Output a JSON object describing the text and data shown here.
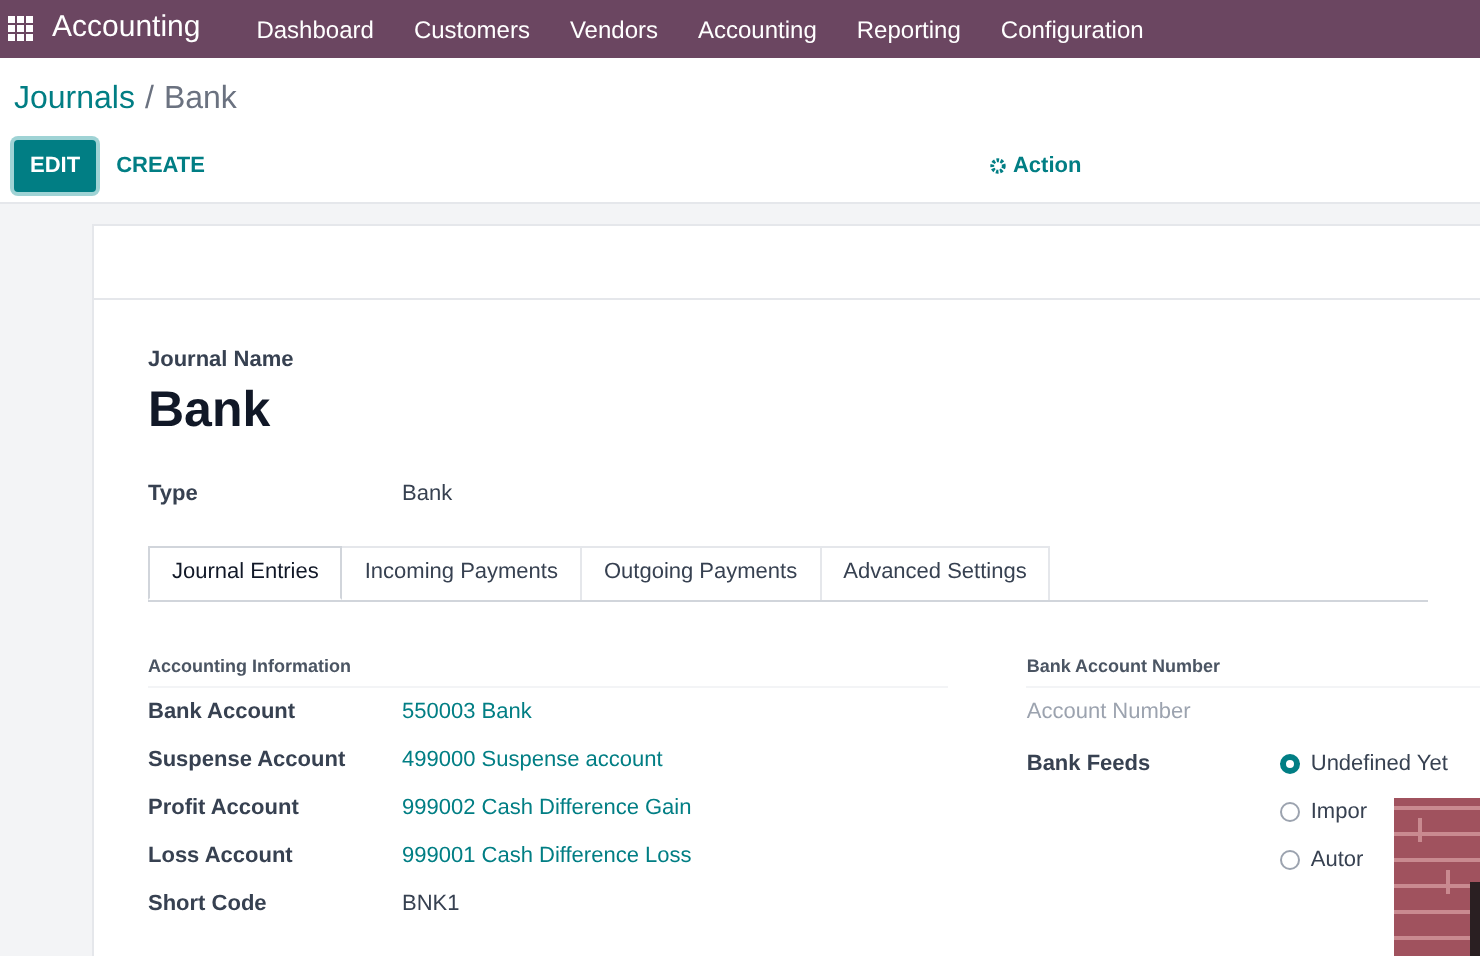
{
  "navbar": {
    "app": "Accounting",
    "menu": [
      "Dashboard",
      "Customers",
      "Vendors",
      "Accounting",
      "Reporting",
      "Configuration"
    ]
  },
  "breadcrumb": {
    "parent": "Journals",
    "separator": "/",
    "current": "Bank"
  },
  "buttons": {
    "edit": "EDIT",
    "create": "CREATE",
    "action": "Action"
  },
  "form": {
    "name_label": "Journal Name",
    "name": "Bank",
    "type_label": "Type",
    "type": "Bank"
  },
  "tabs": [
    {
      "label": "Journal Entries",
      "selected": true
    },
    {
      "label": "Incoming Payments",
      "selected": false
    },
    {
      "label": "Outgoing Payments",
      "selected": false
    },
    {
      "label": "Advanced Settings",
      "selected": false
    }
  ],
  "accounting_info": {
    "title": "Accounting Information",
    "fields": [
      {
        "label": "Bank Account",
        "value": "550003 Bank",
        "kind": "link"
      },
      {
        "label": "Suspense Account",
        "value": "499000 Suspense account",
        "kind": "link"
      },
      {
        "label": "Profit Account",
        "value": "999002 Cash Difference Gain",
        "kind": "link"
      },
      {
        "label": "Loss Account",
        "value": "999001 Cash Difference Loss",
        "kind": "link"
      },
      {
        "label": "Short Code",
        "value": "BNK1",
        "kind": "text"
      }
    ]
  },
  "bank_account": {
    "title": "Bank Account Number",
    "placeholder": "Account Number",
    "feeds_label": "Bank Feeds",
    "feeds": [
      {
        "label": "Undefined Yet",
        "selected": true
      },
      {
        "label": "Impor",
        "selected": false
      },
      {
        "label": "Autor",
        "selected": false
      }
    ]
  }
}
